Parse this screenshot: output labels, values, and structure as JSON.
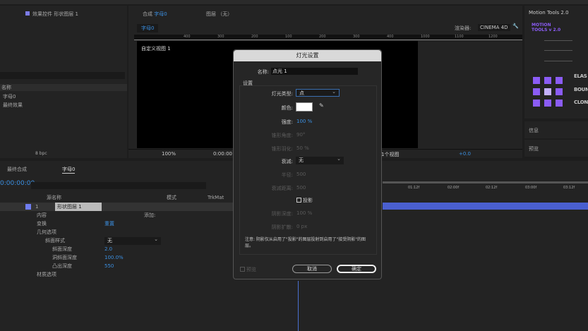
{
  "left_panel": {
    "tab": "效果控件 形状图层 1",
    "col_name": "名称",
    "items": [
      "字母0",
      "最终效果"
    ],
    "bpc": "8 bpc"
  },
  "comp_panel": {
    "tab": "合成",
    "comp_name": "字母0",
    "layer_tab": "图层 （无）",
    "subtab": "字母0",
    "renderer_label": "渲染器:",
    "renderer": "CINEMA 4D",
    "view_label": "自定义视图 1",
    "zoom": "100%",
    "timecode": "0:00:00",
    "views": "1个视图",
    "exposure": "+0.0",
    "ruler": [
      "400",
      "300",
      "200",
      "100",
      "200",
      "300",
      "400",
      "1000",
      "1100",
      "1200"
    ]
  },
  "motion_tools": {
    "title": "Motion Tools 2.0",
    "logo": "MOTION TOOLS v 2.0",
    "buttons": [
      "ELAS",
      "BOUN",
      "CLON"
    ],
    "info": "信息",
    "preview": "预览",
    "accent": "#8b5cf6"
  },
  "timeline": {
    "tabs": [
      "最终合成",
      "字母0"
    ],
    "timecode": "0:00:00:00",
    "search_placeholder": "",
    "headers": {
      "source": "源名称",
      "mode": "模式",
      "trkmat": "TrkMat"
    },
    "layer": {
      "num": "1",
      "name": "形状图层 1"
    },
    "props": [
      {
        "name": "内容",
        "value": "添加:"
      },
      {
        "name": "变换",
        "value": "重置"
      },
      {
        "name": "几何选项",
        "value": ""
      },
      {
        "name": "斜面样式",
        "value": "无"
      },
      {
        "name": "斜面深度",
        "value": "2.0"
      },
      {
        "name": "洞斜面深度",
        "value": "100.0%"
      },
      {
        "name": "凸出深度",
        "value": "550"
      },
      {
        "name": "材质选项",
        "value": ""
      }
    ],
    "ruler": [
      "01:12f",
      "02:00f",
      "02:12f",
      "03:00f",
      "03:12f"
    ],
    "bar_color": "#4a5fd0"
  },
  "dialog": {
    "title": "灯光设置",
    "name_label": "名称:",
    "name_value": "点光 1",
    "section": "设置",
    "light_type_label": "灯光类型:",
    "light_type": "点",
    "color_label": "颜色:",
    "color": "#ffffff",
    "intensity_label": "强度:",
    "intensity": "100 %",
    "cone_angle_label": "锥形角度:",
    "cone_angle": "90°",
    "cone_feather_label": "锥形羽化:",
    "cone_feather": "50 %",
    "falloff_label": "衰减:",
    "falloff": "无",
    "radius_label": "半径:",
    "radius": "500",
    "falloff_dist_label": "衰减距离:",
    "falloff_dist": "500",
    "cast_shadows": "投影",
    "shadow_darkness_label": "阴影深度:",
    "shadow_darkness": "100 %",
    "shadow_diffusion_label": "阴影扩散:",
    "shadow_diffusion": "0 px",
    "note": "注意: 阴影仅从启用了\"投影\"的图层投射到启用了\"接受阴影\"的图层。",
    "preview": "预览",
    "cancel": "取消",
    "ok": "确定"
  }
}
